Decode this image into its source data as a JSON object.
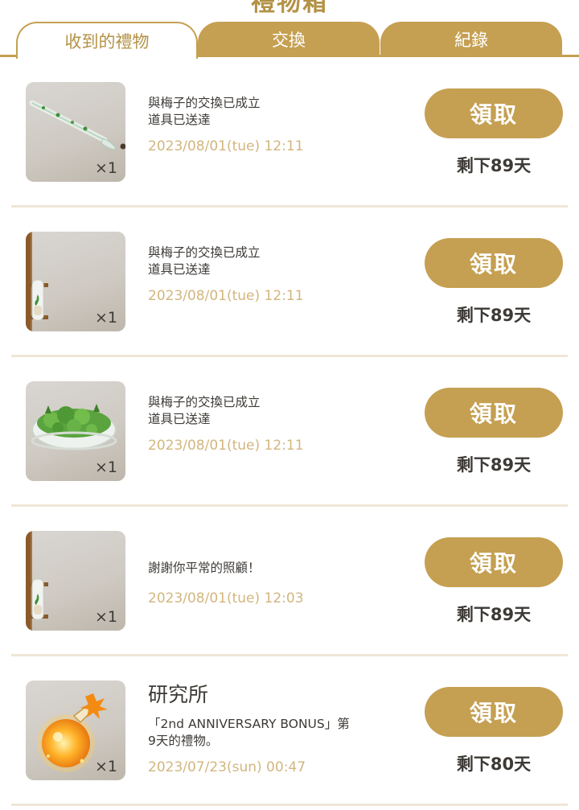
{
  "page": {
    "title": "禮物箱"
  },
  "tabs": [
    {
      "label": "收到的禮物",
      "active": true
    },
    {
      "label": "交換",
      "active": false
    },
    {
      "label": "紀錄",
      "active": false
    }
  ],
  "colors": {
    "accent": "#c5a052",
    "date": "#d2b67f",
    "divider": "#efe6d6",
    "text": "#3d3a36"
  },
  "gifts": [
    {
      "icon": "glass-pipette-icon",
      "quantity": "×1",
      "sender": "",
      "message": "與梅子的交換已成立\n道具已送達",
      "date": "2023/08/01(tue) 12:11",
      "claim_label": "領取",
      "remaining": "剩下89天"
    },
    {
      "icon": "test-tube-shelf-icon",
      "quantity": "×1",
      "sender": "",
      "message": "與梅子的交換已成立\n道具已送達",
      "date": "2023/08/01(tue) 12:11",
      "claim_label": "領取",
      "remaining": "剩下89天"
    },
    {
      "icon": "moss-petri-dish-icon",
      "quantity": "×1",
      "sender": "",
      "message": "與梅子的交換已成立\n道具已送達",
      "date": "2023/08/01(tue) 12:11",
      "claim_label": "領取",
      "remaining": "剩下89天"
    },
    {
      "icon": "test-tube-shelf-icon",
      "quantity": "×1",
      "sender": "",
      "message": "謝謝你平常的照顧！",
      "date": "2023/08/01(tue) 12:03",
      "claim_label": "領取",
      "remaining": "剩下89天"
    },
    {
      "icon": "orange-potion-flask-icon",
      "quantity": "×1",
      "sender": "研究所",
      "message": "「2nd ANNIVERSARY BONUS」第\n9天的禮物。",
      "date": "2023/07/23(sun) 00:47",
      "claim_label": "領取",
      "remaining": "剩下80天"
    }
  ]
}
